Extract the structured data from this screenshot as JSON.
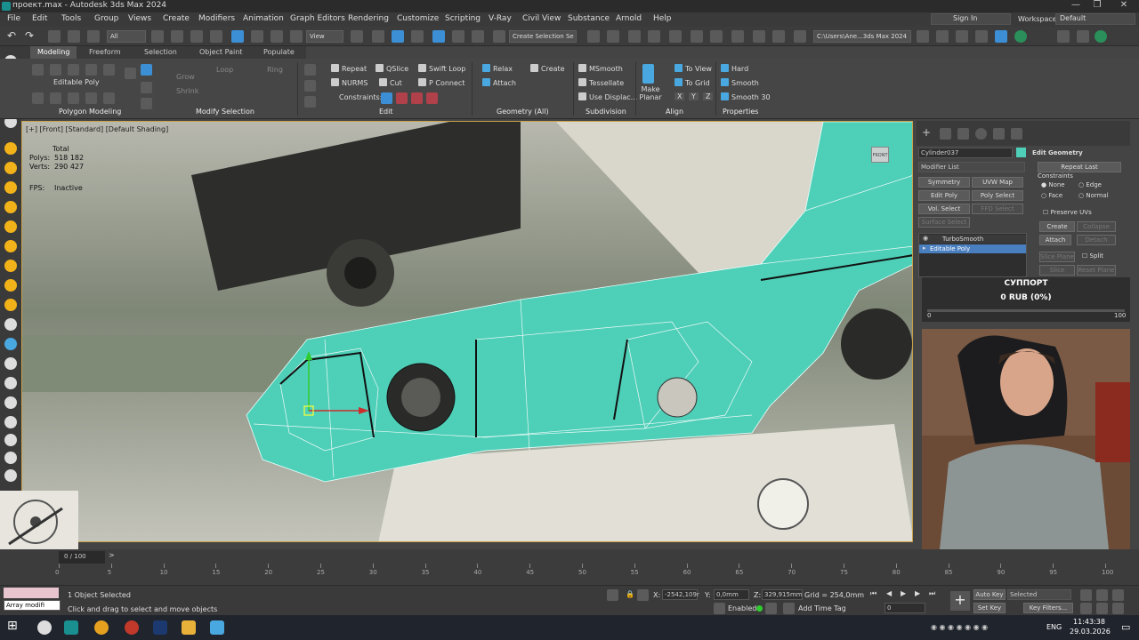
{
  "window": {
    "title": "проект.max - Autodesk 3ds Max 2024"
  },
  "menu": {
    "items": [
      "File",
      "Edit",
      "Tools",
      "Group",
      "Views",
      "Create",
      "Modifiers",
      "Animation",
      "Graph Editors",
      "Rendering",
      "Customize",
      "Scripting",
      "V-Ray",
      "Civil View",
      "Substance",
      "Arnold",
      "Help"
    ],
    "signin": "Sign In",
    "workspaces_label": "Workspaces:",
    "workspace": "Default"
  },
  "toolbar": {
    "filter": "All",
    "view": "View",
    "selection_set": "Create Selection Se",
    "path": "C:\\Users\\Ane...3ds Max 2024"
  },
  "ribbon": {
    "tabs": [
      "Modeling",
      "Freeform",
      "Selection",
      "Object Paint",
      "Populate"
    ],
    "editable_poly": "Editable Poly",
    "grow": "Grow",
    "shrink": "Shrink",
    "loop": "Loop",
    "ring": "Ring",
    "edit": {
      "repeat": "Repeat",
      "qslice": "QSlice",
      "swift_loop": "Swift Loop",
      "nurms": "NURMS",
      "cut": "Cut",
      "p_connect": "P Connect",
      "constraints": "Constraints:"
    },
    "geometry": {
      "relax": "Relax",
      "create": "Create",
      "attach": "Attach"
    },
    "subdivision": {
      "msmooth": "MSmooth",
      "tessellate": "Tessellate",
      "use_displac": "Use Displac..."
    },
    "align": {
      "make_planar": "Make Planar",
      "to_view": "To View",
      "to_grid": "To Grid",
      "x": "X",
      "y": "Y",
      "z": "Z"
    },
    "properties": {
      "hard": "Hard",
      "smooth": "Smooth",
      "smooth30": "Smooth 30"
    },
    "groups": [
      "Polygon Modeling",
      "Modify Selection",
      "Edit",
      "Geometry (All)",
      "Subdivision",
      "Align",
      "Properties"
    ]
  },
  "viewport": {
    "label": "[+] [Front] [Standard] [Default Shading]",
    "stats_total": "Total",
    "polys_label": "Polys:",
    "polys": "518 182",
    "verts_label": "Verts:",
    "verts": "290 427",
    "fps_label": "FPS:",
    "fps": "Inactive",
    "viewcube": "FRONT",
    "mesh_color": "#4ecfb8"
  },
  "command_panel": {
    "object_name": "Cylinder037",
    "modifier_list": "Modifier List",
    "buttons": [
      "Symmetry",
      "UVW Map",
      "Edit Poly",
      "Poly Select",
      "Vol. Select",
      "FFD Select",
      "Surface Select"
    ],
    "stack": [
      "TurboSmooth",
      "Editable Poly"
    ],
    "rollout": "Edit Geometry",
    "repeat_last": "Repeat Last",
    "constraints": "Constraints",
    "none": "None",
    "edge": "Edge",
    "face": "Face",
    "normal": "Normal",
    "preserve_uvs": "Preserve UVs",
    "create": "Create",
    "collapse": "Collapse",
    "attach": "Attach",
    "detach": "Detach",
    "slice_plane": "Slice Plane",
    "split": "Split",
    "slice": "Slice",
    "reset_plane": "Reset Plane"
  },
  "support": {
    "title": "СУППОРТ",
    "amount": "0 RUB (0%)",
    "min": "0",
    "max": "100",
    "progress": 0
  },
  "timeline": {
    "frame": "0 / 100",
    "ticks": [
      "0",
      "5",
      "10",
      "15",
      "20",
      "25",
      "30",
      "35",
      "40",
      "45",
      "50",
      "55",
      "60",
      "65",
      "70",
      "75",
      "80",
      "85",
      "90",
      "95",
      "100"
    ]
  },
  "status": {
    "listener": "Array modifi",
    "selected": "1 Object Selected",
    "hint": "Click and drag to select and move objects",
    "x_label": "X:",
    "x": "-2542,109r",
    "y_label": "Y:",
    "y": "0,0mm",
    "z_label": "Z:",
    "z": "329,915mm",
    "grid": "Grid = 254,0mm",
    "enabled": "Enabled:",
    "add_time_tag": "Add Time Tag",
    "auto_key": "Auto Key",
    "set_key": "Set Key",
    "selected_dd": "Selected",
    "key_filters": "Key Filters...",
    "frame_field": "0"
  },
  "taskbar": {
    "lang": "ENG",
    "time": "11:43:38",
    "date": "29.03.2026"
  }
}
